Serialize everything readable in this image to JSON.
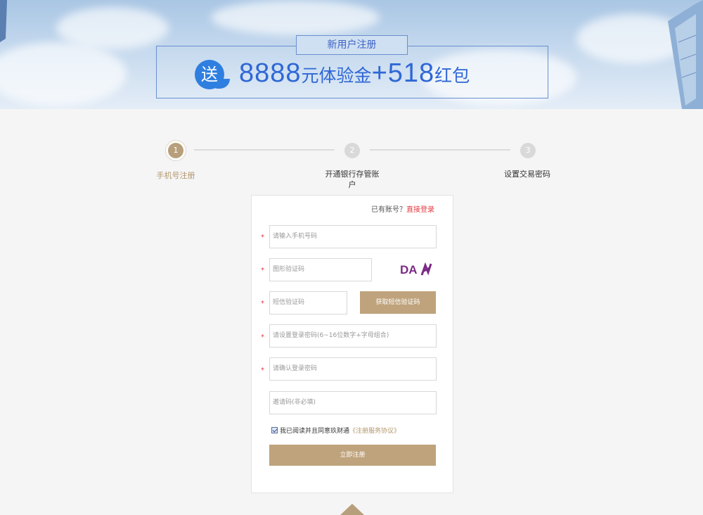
{
  "banner": {
    "new_user_label": "新用户注册",
    "badge_text": "送",
    "amount": "8888",
    "amount_suffix": "元体验金",
    "plus": "+",
    "bonus": "518",
    "bonus_suffix": "红包"
  },
  "steps": [
    {
      "number": "1",
      "label": "手机号注册",
      "active": true
    },
    {
      "number": "2",
      "label": "开通银行存管账户",
      "active": false
    },
    {
      "number": "3",
      "label": "设置交易密码",
      "active": false
    }
  ],
  "form": {
    "has_account_text": "已有账号？",
    "login_link": "直接登录",
    "required_mark": "*",
    "phone_placeholder": "请输入手机号码",
    "captcha_placeholder": "图形验证码",
    "captcha_text": "DA",
    "sms_placeholder": "短信验证码",
    "sms_button": "获取短信验证码",
    "password_placeholder": "请设置登录密码(6~16位数字+字母组合)",
    "confirm_placeholder": "请确认登录密码",
    "invite_placeholder": "邀请码(非必填)",
    "agree_text": "我已阅读并且同意玖财通",
    "terms_link": "《注册服务协议》",
    "submit_button": "立即注册"
  },
  "colors": {
    "accent": "#bfa37c",
    "link_red": "#e4393c",
    "banner_blue": "#2f67d6"
  }
}
